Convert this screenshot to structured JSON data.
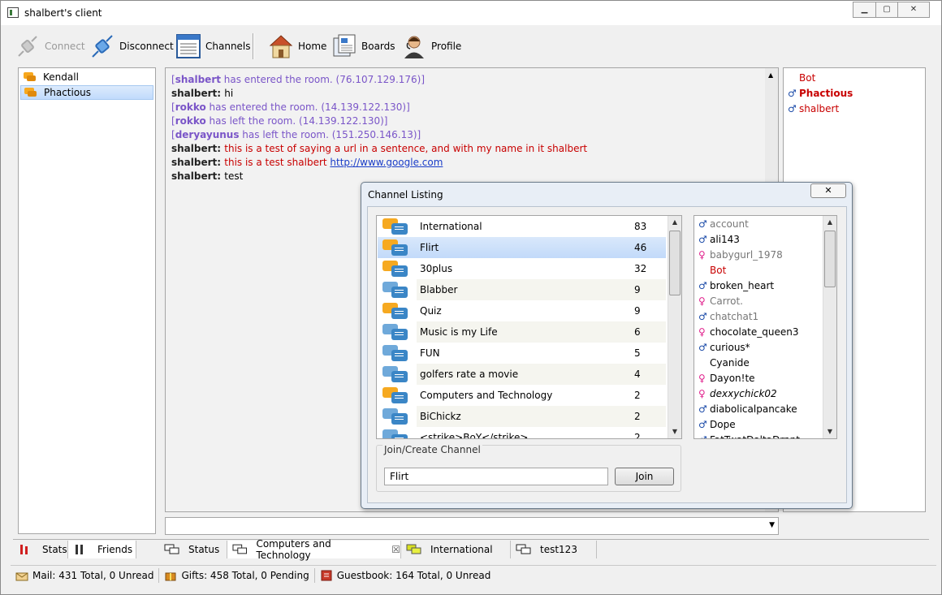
{
  "window": {
    "title": "shalbert's client"
  },
  "toolbar": {
    "connect": "Connect",
    "disconnect": "Disconnect",
    "channels": "Channels",
    "home": "Home",
    "boards": "Boards",
    "profile": "Profile"
  },
  "friends": [
    "Kendall",
    "Phactious"
  ],
  "chat": [
    {
      "type": "system",
      "nick": "shalbert",
      "text": " has entered the room. (76.107.129.176)"
    },
    {
      "type": "msg",
      "nick": "shalbert",
      "text": "hi"
    },
    {
      "type": "system",
      "nick": "rokko",
      "text": " has entered the room. (14.139.122.130)"
    },
    {
      "type": "system",
      "nick": "rokko",
      "text": " has left the room. (14.139.122.130)"
    },
    {
      "type": "system",
      "nick": "deryayunus",
      "text": " has left the room. (151.250.146.13)"
    },
    {
      "type": "highlight",
      "nick": "shalbert",
      "text": "this is a test of saying a url in a sentence, and with my name in it shalbert"
    },
    {
      "type": "link",
      "nick": "shalbert",
      "text": "this is a test shalbert ",
      "link": "http://www.google.com"
    },
    {
      "type": "msg",
      "nick": "shalbert",
      "text": "test"
    }
  ],
  "room_users": [
    {
      "name": "Bot",
      "gender": "none",
      "bold": false
    },
    {
      "name": "Phactious",
      "gender": "male",
      "bold": true
    },
    {
      "name": "shalbert",
      "gender": "male",
      "bold": false
    }
  ],
  "dialog": {
    "title": "Channel Listing",
    "close": "✕",
    "channels": [
      {
        "name": "International",
        "count": "83",
        "icon": "orange"
      },
      {
        "name": "Flirt",
        "count": "46",
        "icon": "orange"
      },
      {
        "name": "30plus",
        "count": "32",
        "icon": "orange"
      },
      {
        "name": "Blabber",
        "count": "9",
        "icon": "blue"
      },
      {
        "name": "Quiz",
        "count": "9",
        "icon": "orange"
      },
      {
        "name": "Music is my Life",
        "count": "6",
        "icon": "blue"
      },
      {
        "name": "FUN",
        "count": "5",
        "icon": "blue"
      },
      {
        "name": "golfers rate a movie",
        "count": "4",
        "icon": "blue"
      },
      {
        "name": "Computers and Technology",
        "count": "2",
        "icon": "orange"
      },
      {
        "name": "BiChickz",
        "count": "2",
        "icon": "blue"
      },
      {
        "name": "<strike>BoY</strike>",
        "count": "2",
        "icon": "blue"
      }
    ],
    "members": [
      {
        "name": "account",
        "gender": "male",
        "style": "gray"
      },
      {
        "name": "ali143",
        "gender": "male",
        "style": "normal"
      },
      {
        "name": "babygurl_1978",
        "gender": "female",
        "style": "gray"
      },
      {
        "name": "Bot",
        "gender": "none",
        "style": "red"
      },
      {
        "name": "broken_heart",
        "gender": "male",
        "style": "normal"
      },
      {
        "name": "Carrot.",
        "gender": "female",
        "style": "gray"
      },
      {
        "name": "chatchat1",
        "gender": "male",
        "style": "gray"
      },
      {
        "name": "chocolate_queen3",
        "gender": "female",
        "style": "normal"
      },
      {
        "name": "curious*",
        "gender": "male",
        "style": "normal"
      },
      {
        "name": "Cyanide",
        "gender": "none",
        "style": "normal"
      },
      {
        "name": "Dayon!te",
        "gender": "female",
        "style": "normal"
      },
      {
        "name": "dexxychick02",
        "gender": "female",
        "style": "italic"
      },
      {
        "name": "diabolicalpancake",
        "gender": "male",
        "style": "normal"
      },
      {
        "name": "Dope",
        "gender": "male",
        "style": "normal"
      },
      {
        "name": "FatTwatDaltaDrnnt",
        "gender": "male",
        "style": "normal"
      }
    ],
    "join_group_label": "Join/Create Channel",
    "join_value": "Flirt",
    "join_button": "Join"
  },
  "tabs": [
    {
      "label": "Stats"
    },
    {
      "label": "Friends"
    },
    {
      "label": "Status"
    },
    {
      "label": "Computers and Technology"
    },
    {
      "label": "International"
    },
    {
      "label": "test123"
    }
  ],
  "tab_close": "☒",
  "status": {
    "mail": "Mail: 431 Total, 0 Unread",
    "gifts": "Gifts: 458 Total, 0 Pending",
    "guestbook": "Guestbook: 164 Total, 0 Unread"
  },
  "colors": {
    "accent": "#3b86c6",
    "system": "#7a55c8",
    "highlight": "#c80000",
    "link": "#1a3dc8"
  }
}
